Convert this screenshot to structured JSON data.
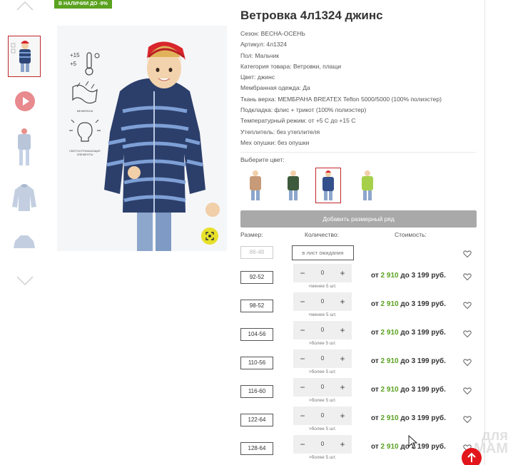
{
  "badge": "В НАЛИЧИИ ДО -9%",
  "product": {
    "title": "Ветровка 4л1324 джинс",
    "specs": [
      "Сезон: ВЕСНА-ОСЕНЬ",
      "Артикул: 4л1324",
      "Пол: Мальчик",
      "Категория товара: Ветровки, плащи",
      "Цвет: джинс",
      "Мембранная одежда: Да",
      "Ткань верха: МЕМБРАНА BREATEX Teflon 5000/5000 (100% полиэстер)",
      "Подкладка: флис + трикот (100% полиэстер)",
      "Температурный режим: от +5 С до +15 С",
      "Утеплитель: без утеплителя",
      "Мех опушки: без опушки"
    ]
  },
  "features": {
    "temp_top": "+15",
    "temp_bottom": "+5",
    "membrane": "МЕМБРАНА",
    "reflective": "СВЕТООТРАЖАЮЩИЕ ЭЛЕМЕНТЫ"
  },
  "color_choice": {
    "label": "Выберите цвет:",
    "swatches": [
      {
        "color": "#c79a78"
      },
      {
        "color": "#3d5a3c"
      },
      {
        "color": "#34508c"
      },
      {
        "color": "#a6d04a"
      }
    ]
  },
  "add_size_button": "Добавить размерный ряд",
  "table_headers": {
    "size": "Размер:",
    "qty": "Количество:",
    "cost": "Стоимость:"
  },
  "unavailable": {
    "size": "86-48",
    "wait_button": "в лист ожидания"
  },
  "sizes": [
    {
      "size": "92-52",
      "qty": "0",
      "note": "<менее 5 шт.",
      "price_prefix": "от ",
      "price_from": "2 910",
      "price_suffix": " до 3 199 руб."
    },
    {
      "size": "98-52",
      "qty": "0",
      "note": "<менее 5 шт.",
      "price_prefix": "от ",
      "price_from": "2 910",
      "price_suffix": " до 3 199 руб."
    },
    {
      "size": "104-56",
      "qty": "0",
      "note": ">более 5 шт.",
      "price_prefix": "от ",
      "price_from": "2 910",
      "price_suffix": " до 3 199 руб."
    },
    {
      "size": "110-56",
      "qty": "0",
      "note": ">более 5 шт.",
      "price_prefix": "от ",
      "price_from": "2 910",
      "price_suffix": " до 3 199 руб."
    },
    {
      "size": "116-60",
      "qty": "0",
      "note": ">более 5 шт.",
      "price_prefix": "от ",
      "price_from": "2 910",
      "price_suffix": " до 3 199 руб."
    },
    {
      "size": "122-64",
      "qty": "0",
      "note": ">более 5 шт.",
      "price_prefix": "от ",
      "price_from": "2 910",
      "price_suffix": " до 3 199 руб."
    },
    {
      "size": "128-64",
      "qty": "0",
      "note": ">более 5 шт.",
      "price_prefix": "от ",
      "price_from": "2 910",
      "price_suffix": " до 3 199 руб."
    }
  ],
  "stepper": {
    "minus": "−",
    "plus": "+"
  },
  "watermark": "для МАМ",
  "colors": {
    "accent_red": "#c0262c",
    "green": "#5aa21f",
    "button_gray": "#a9a9a9",
    "up_button": "#e3151c"
  }
}
